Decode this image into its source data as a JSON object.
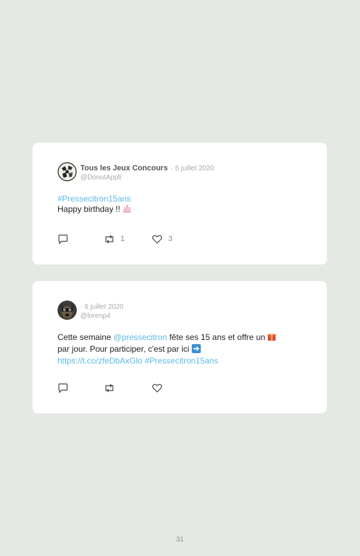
{
  "tweets": [
    {
      "author": "Tous les Jeux Concours",
      "date": "· 6 juillet 2020",
      "handle": "@DonutAppli",
      "hashtag": "#Pressecitron15ans",
      "text": "Happy birthday !! ",
      "emoji": "birthday-cake-icon",
      "retweets": "1",
      "likes": "3"
    },
    {
      "author": "",
      "date": "· 6 juillet 2020",
      "handle": "@lorenp4",
      "text_part1": "Cette semaine ",
      "mention": "@pressecitron",
      "text_part2": " fête ses 15 ans et offre un ",
      "emoji1": "gift-icon",
      "text_part3": " par jour. Pour participer, c'est par ici ",
      "emoji2": "arrow-right-icon",
      "url": "https://t.co/zfeDbAxGlo",
      "hashtag": "#Pressecitron15ans",
      "retweets": "",
      "likes": ""
    }
  ],
  "page_number": "31",
  "colors": {
    "background": "#e5e9e3",
    "link": "#5bb9e6",
    "card": "#ffffff"
  }
}
